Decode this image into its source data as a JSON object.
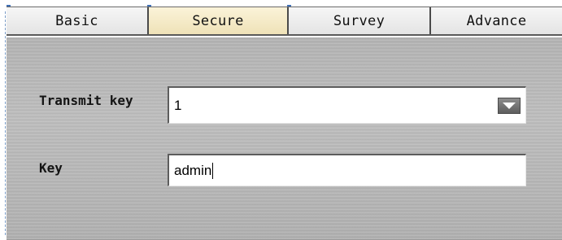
{
  "tabs": [
    {
      "label": "Basic",
      "selected": false
    },
    {
      "label": "Secure",
      "selected": true
    },
    {
      "label": "Survey",
      "selected": false
    },
    {
      "label": "Advance",
      "selected": false
    }
  ],
  "form": {
    "transmit_key": {
      "label": "Transmit key",
      "value": "1"
    },
    "key": {
      "label": "Key",
      "value": "admin"
    }
  },
  "colors": {
    "selected_tab": "#efe2b8",
    "panel": "#b3b3b3",
    "accent_corner": "#3e6fb5"
  },
  "icons": {
    "dropdown": "chevron-down-icon"
  }
}
